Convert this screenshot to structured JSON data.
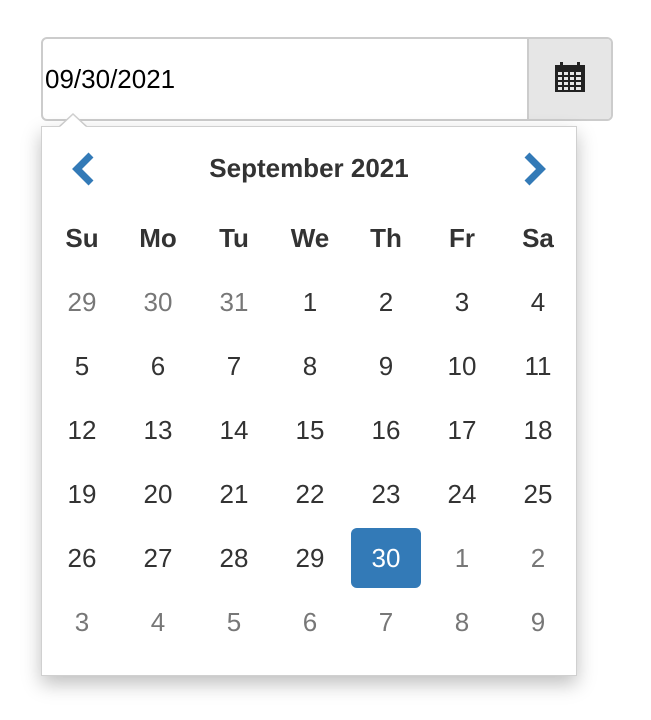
{
  "date_input": {
    "value": "09/30/2021"
  },
  "calendar_button": {
    "icon": "calendar-icon"
  },
  "picker": {
    "month_title": "September 2021",
    "prev_icon": "chevron-left-icon",
    "next_icon": "chevron-right-icon",
    "accent_color": "#337ab7",
    "weekdays": [
      "Su",
      "Mo",
      "Tu",
      "We",
      "Th",
      "Fr",
      "Sa"
    ],
    "weeks": [
      [
        {
          "d": "29",
          "muted": true
        },
        {
          "d": "30",
          "muted": true
        },
        {
          "d": "31",
          "muted": true
        },
        {
          "d": "1"
        },
        {
          "d": "2"
        },
        {
          "d": "3"
        },
        {
          "d": "4"
        }
      ],
      [
        {
          "d": "5"
        },
        {
          "d": "6"
        },
        {
          "d": "7"
        },
        {
          "d": "8"
        },
        {
          "d": "9"
        },
        {
          "d": "10"
        },
        {
          "d": "11"
        }
      ],
      [
        {
          "d": "12"
        },
        {
          "d": "13"
        },
        {
          "d": "14"
        },
        {
          "d": "15"
        },
        {
          "d": "16"
        },
        {
          "d": "17"
        },
        {
          "d": "18"
        }
      ],
      [
        {
          "d": "19"
        },
        {
          "d": "20"
        },
        {
          "d": "21"
        },
        {
          "d": "22"
        },
        {
          "d": "23"
        },
        {
          "d": "24"
        },
        {
          "d": "25"
        }
      ],
      [
        {
          "d": "26"
        },
        {
          "d": "27"
        },
        {
          "d": "28"
        },
        {
          "d": "29"
        },
        {
          "d": "30",
          "active": true
        },
        {
          "d": "1",
          "muted": true
        },
        {
          "d": "2",
          "muted": true
        }
      ],
      [
        {
          "d": "3",
          "muted": true
        },
        {
          "d": "4",
          "muted": true
        },
        {
          "d": "5",
          "muted": true
        },
        {
          "d": "6",
          "muted": true
        },
        {
          "d": "7",
          "muted": true
        },
        {
          "d": "8",
          "muted": true
        },
        {
          "d": "9",
          "muted": true
        }
      ]
    ]
  }
}
